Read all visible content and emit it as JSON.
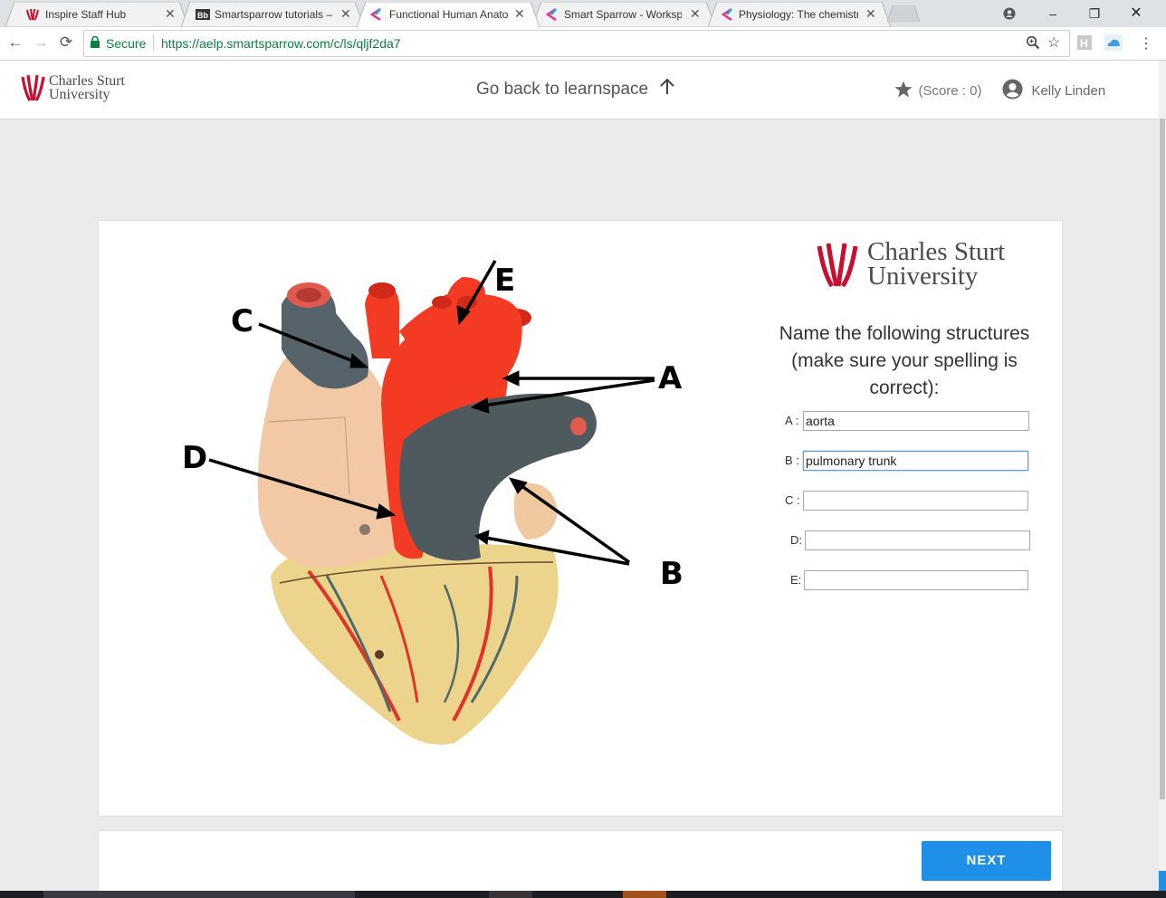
{
  "browser": {
    "tabs": [
      {
        "title": "Inspire Staff Hub",
        "icon": "csu-logo-icon",
        "active": false
      },
      {
        "title": "Smartsparrow tutorials –",
        "icon": "blackboard-icon",
        "active": false
      },
      {
        "title": "Functional Human Anato",
        "icon": "smartsparrow-icon",
        "active": true
      },
      {
        "title": "Smart Sparrow - Worksp",
        "icon": "smartsparrow-icon",
        "active": false
      },
      {
        "title": "Physiology: The chemistr",
        "icon": "smartsparrow-icon",
        "active": false
      }
    ],
    "secure_label": "Secure",
    "url": "https://aelp.smartsparrow.com/c/ls/qljf2da7"
  },
  "header": {
    "logo_line1": "Charles Sturt",
    "logo_line2": "University",
    "back_link": "Go back to learnspace",
    "score": "(Score : 0)",
    "user_name": "Kelly Linden"
  },
  "lesson": {
    "diagram_labels": [
      "A",
      "B",
      "C",
      "D",
      "E"
    ],
    "logo_line1": "Charles Sturt",
    "logo_line2": "University",
    "question_line1": "Name the following structures",
    "question_line2": "(make sure your spelling is",
    "question_line3": "correct):",
    "fields": [
      {
        "label": "A :",
        "value": "aorta"
      },
      {
        "label": "B :",
        "value": "pulmonary trunk"
      },
      {
        "label": "C :",
        "value": ""
      },
      {
        "label": "D:",
        "value": ""
      },
      {
        "label": "E:",
        "value": ""
      }
    ],
    "next_label": "NEXT"
  },
  "colors": {
    "brand_red": "#c8102e",
    "accent_blue": "#1f8fe8",
    "heart_red": "#f23b22",
    "vessel_grey": "#4f5a5e"
  }
}
